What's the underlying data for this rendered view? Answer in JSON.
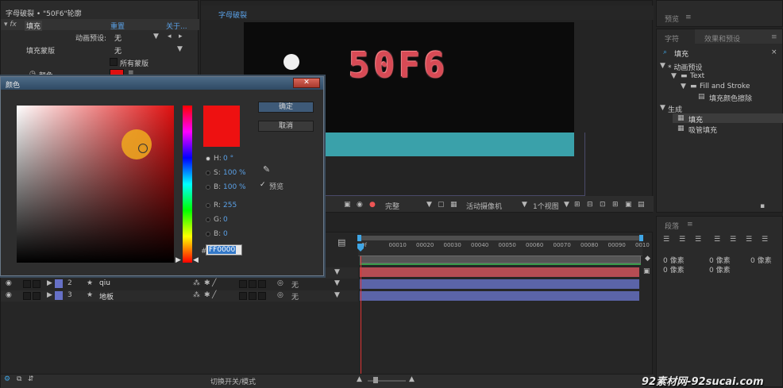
{
  "effect_controls": {
    "title": "字母破裂 • \"50F6\"轮廓",
    "effect_name": "填充",
    "reset": "重置",
    "about": "关于...",
    "preset_label": "动画预设:",
    "preset_value": "无",
    "fill_mask_label": "填充蒙版",
    "fill_mask_value": "无",
    "all_masks": "所有蒙版",
    "color_label": "颜色"
  },
  "color_dialog": {
    "title": "颜色",
    "ok": "确定",
    "cancel": "取消",
    "h_label": "H:",
    "h_value": "0 °",
    "s_label": "S:",
    "s_value": "100 %",
    "b_label": "B:",
    "b_value": "100 %",
    "r_label": "R:",
    "r_value": "255",
    "g_label": "G:",
    "g_value": "0",
    "b2_label": "B:",
    "b2_value": "0",
    "hash": "#",
    "hex": "FF0000",
    "preview": "预览",
    "current_color": "#ee1111",
    "hue_color": "#ff0000"
  },
  "composition": {
    "tab": "字母破裂",
    "logo_text": "50F6",
    "quality": "完整",
    "camera": "活动摄像机",
    "views": "1个视图"
  },
  "timeline": {
    "ticks": [
      "0f",
      "00010",
      "00020",
      "00030",
      "00040",
      "00050",
      "00060",
      "00070",
      "00080",
      "00090",
      "0010"
    ],
    "layers": [
      {
        "num": "2",
        "name": "qiu",
        "mode": "无",
        "color": "#6670c6"
      },
      {
        "num": "3",
        "name": "地板",
        "mode": "无",
        "color": "#6670c6"
      }
    ],
    "toggle_label": "切换开关/模式"
  },
  "right_panel": {
    "preview_tab": "预览",
    "char_tab": "字符",
    "effects_tab": "效果和预设",
    "search_value": "填充",
    "tree": [
      {
        "label": "* 动画预设",
        "indent": 0
      },
      {
        "label": "Text",
        "indent": 1
      },
      {
        "label": "Fill and Stroke",
        "indent": 2
      },
      {
        "label": "填充颜色擦除",
        "indent": 3
      },
      {
        "label": "生成",
        "indent": 0
      },
      {
        "label": "填充",
        "indent": 1
      },
      {
        "label": "吸管填充",
        "indent": 1
      }
    ],
    "para_tab": "段落",
    "para_values": [
      "0 像素",
      "0 像素",
      "0 像素",
      "0 像素",
      "0 像素"
    ]
  },
  "watermark": "92素材网-92sucai.com"
}
